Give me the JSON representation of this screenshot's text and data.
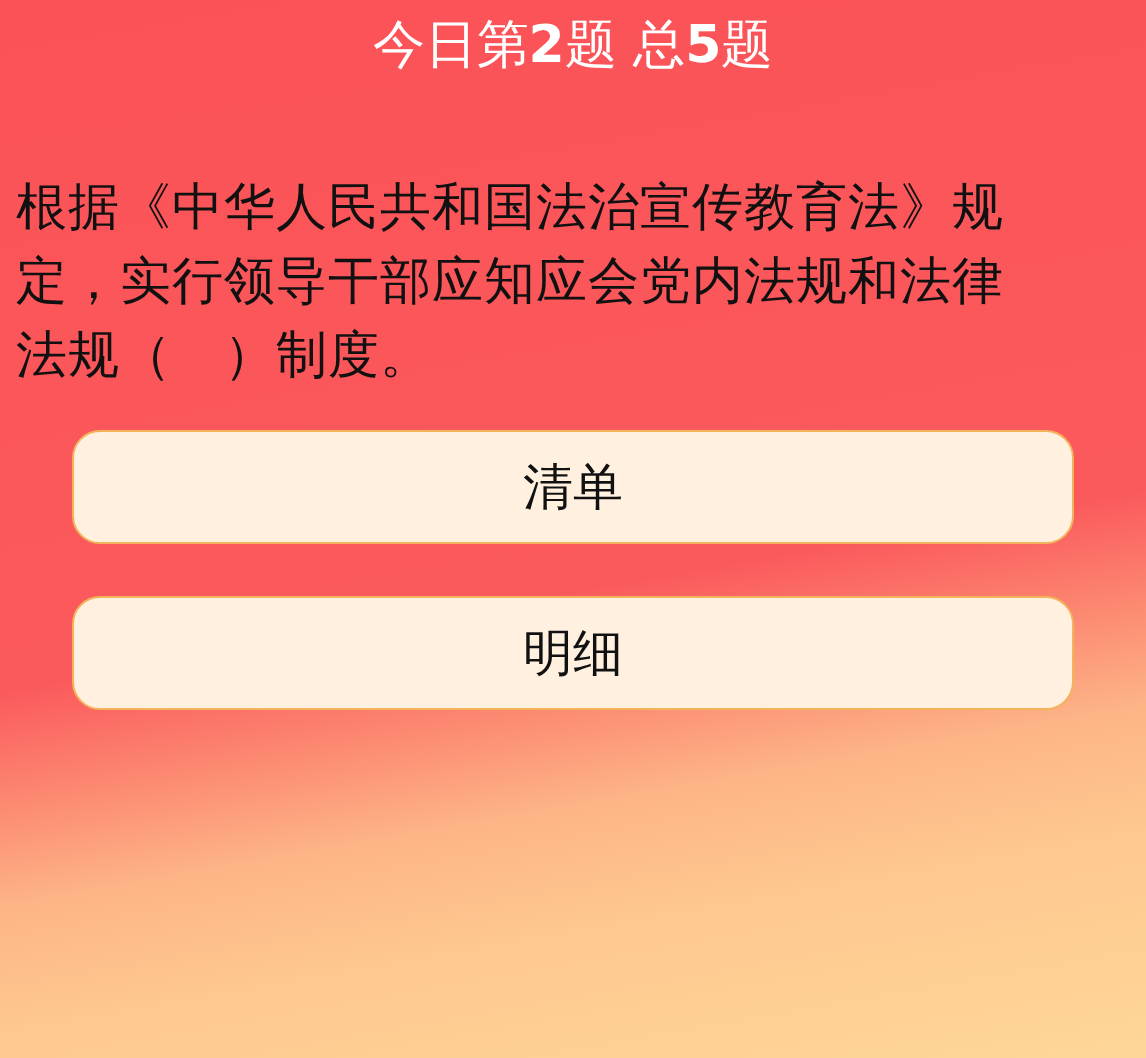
{
  "header": {
    "title": "今日第**2**题  总**5**题"
  },
  "question": {
    "text": "根据《中华人民共和国法治宣传教育法》规定，实行领导干部应知应会党内法规和法律法规（　）制度。"
  },
  "options": [
    {
      "label": "清单"
    },
    {
      "label": "明细"
    }
  ]
}
